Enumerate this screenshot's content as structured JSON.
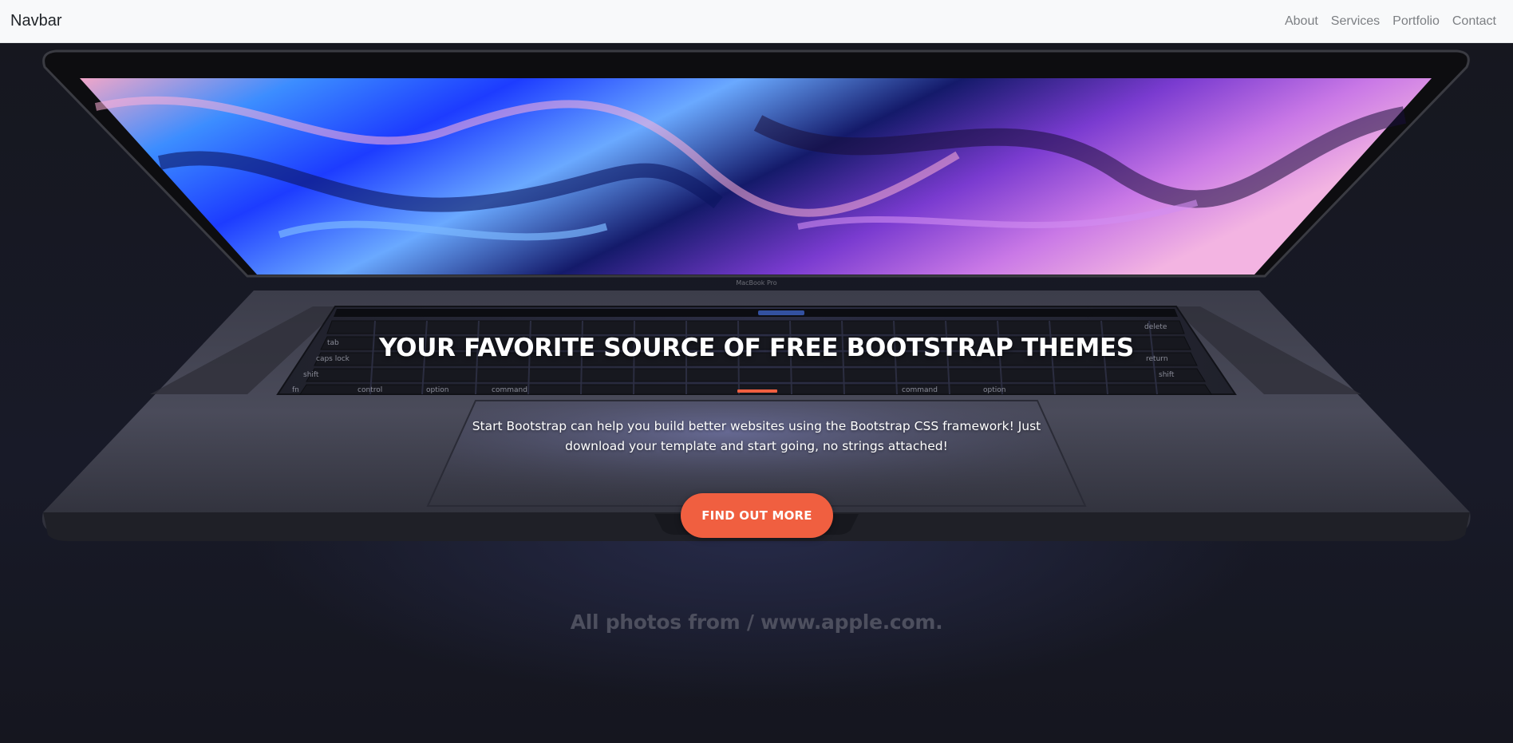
{
  "navbar": {
    "brand": "Navbar",
    "links": [
      "About",
      "Services",
      "Portfolio",
      "Contact"
    ]
  },
  "hero": {
    "title": "YOUR FAVORITE SOURCE OF FREE BOOTSTRAP THEMES",
    "lead": "Start Bootstrap can help you build better websites using the Bootstrap CSS framework! Just download your template and start going, no strings attached!",
    "cta_label": "FIND OUT MORE",
    "photo_credit": "All photos from / www.apple.com.",
    "laptop_label": "MacBook Pro",
    "key_labels": {
      "tab": "tab",
      "caps": "caps lock",
      "shift": "shift",
      "fn": "fn",
      "control": "control",
      "option": "option",
      "command": "command",
      "command_r": "command",
      "option_r": "option",
      "return": "return",
      "shift_r": "shift",
      "delete": "delete"
    }
  },
  "colors": {
    "accent": "#f05f40",
    "navbar_bg": "#f8f9fa",
    "hero_bg": "#14151f"
  }
}
